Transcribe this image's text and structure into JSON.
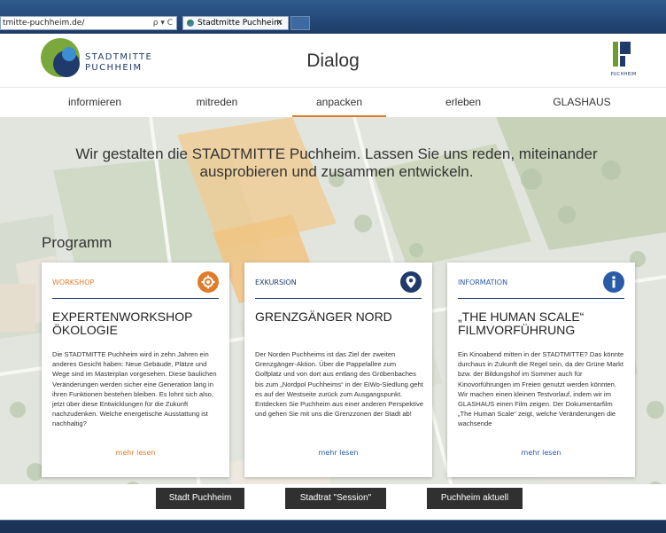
{
  "browser": {
    "address": "tmitte-puchheim.de/",
    "address_icons": "ρ ▾ C",
    "tab_title": "Stadtmitte Puchheim",
    "tab_close": "×"
  },
  "header": {
    "logo_line1": "STADTMITTE",
    "logo_line2": "PUCHHEIM",
    "title": "Dialog",
    "right_logo_text": "PUCHHEIM"
  },
  "nav": {
    "items": [
      "informieren",
      "mitreden",
      "anpacken",
      "erleben",
      "GLASHAUS"
    ]
  },
  "hero": {
    "tagline": "Wir gestalten die STADTMITTE Puchheim. Lassen Sie uns reden, miteinander ausprobieren und zusammen entwickeln.",
    "program_heading": "Programm"
  },
  "cards": [
    {
      "category": "WORKSHOP",
      "title": "EXPERTENWORKSHOP ÖKOLOGIE",
      "body": "Die STADTMITTE Puchheim wird in zehn Jahren ein anderes Gesicht haben: Neue Gebäude, Plätze und Wege sind im Masterplan vorgesehen. Diese baulichen Veränderungen werden sicher eine Generation lang in ihren Funktionen bestehen bleiben. Es lohnt sich also, jetzt über diese Entwicklungen für die Zukunft nachzudenken. Welche energetische Ausstattung ist nachhaltig?",
      "more": "mehr lesen",
      "icon": "gear-icon",
      "color": "#e07b2a"
    },
    {
      "category": "EXKURSION",
      "title": "GRENZGÄNGER NORD",
      "body": "Der Norden Puchheims ist das Ziel der zweiten Grenzgänger-Aktion. Über die Pappelallee zum Golfplatz und von dort aus entlang des Gröbenbaches bis zum „Nordpol Puchheims“ in der EiWo-Siedlung geht es auf der Westseite zurück zum Ausgangspunkt. Entdecken Sie Puchheim aus einer anderen Perspektive und gehen Sie mit uns die Grenzzonen der Stadt ab!",
      "more": "mehr lesen",
      "icon": "location-pin-icon",
      "color": "#1f3a6b"
    },
    {
      "category": "INFORMATION",
      "title": "„THE HUMAN SCALE“ FILMVORFÜHRUNG",
      "body": "Ein Kinoabend mitten in der STADTMITTE? Das könnte durchaus in Zukunft die Regel sein, da der Grüne Markt bzw. der Bildungshof im Sommer auch für Kinovorführungen im Freien genutzt werden könnten. Wir machen einen kleinen Testvorlauf, indem wir im GLASHAUS einen Film zeigen. Der Dokumentarfilm „The Human Scale“ zeigt, welche Veränderungen die wachsende",
      "more": "mehr lesen",
      "icon": "info-icon",
      "color": "#2a5ba8"
    }
  ],
  "footer": {
    "buttons": [
      "Stadt Puchheim",
      "Stadtrat \"Session\"",
      "Puchheim aktuell"
    ]
  }
}
